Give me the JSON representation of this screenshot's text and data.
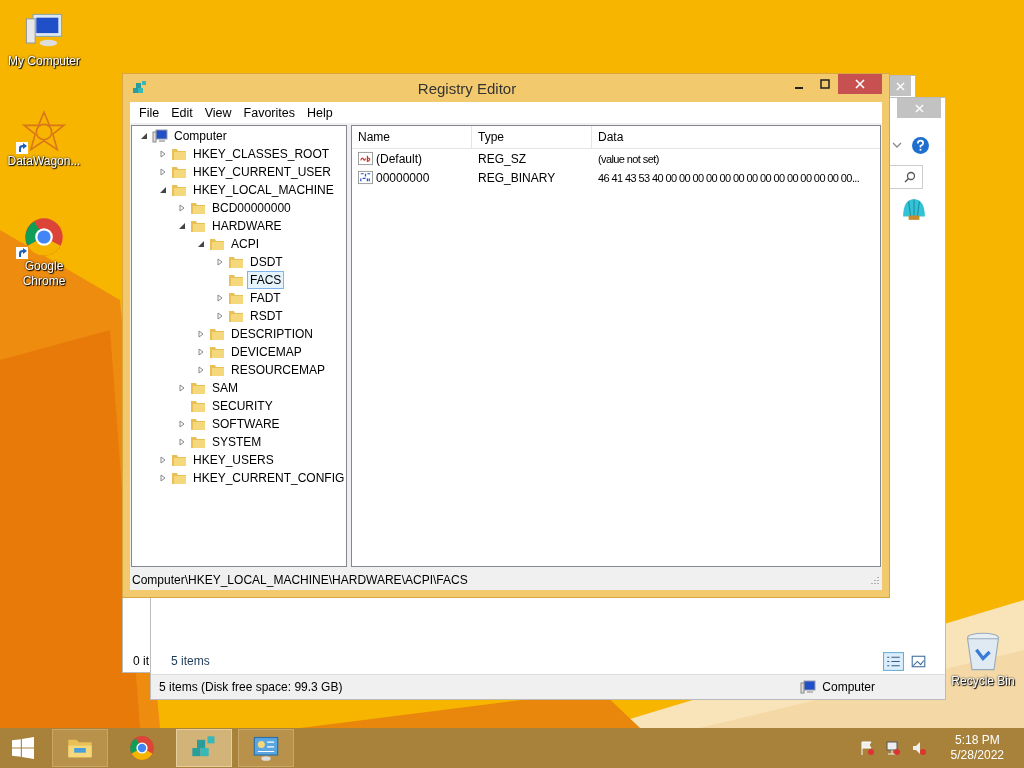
{
  "desktop_icons": [
    {
      "label": "My Computer",
      "kind": "computer",
      "shortcut": false
    },
    {
      "label": "DataWagon...",
      "kind": "star",
      "shortcut": true
    },
    {
      "label": "Google Chrome",
      "kind": "chrome",
      "shortcut": true
    },
    {
      "label": "Recycle Bin",
      "kind": "recycle",
      "shortcut": false
    }
  ],
  "background_windows": [
    {
      "status": "0 it"
    },
    {
      "items_count": "5 items",
      "status_text": "5 items (Disk free space: 99.3 GB)",
      "location": "Computer"
    }
  ],
  "registry_editor": {
    "title": "Registry Editor",
    "menu": [
      "File",
      "Edit",
      "View",
      "Favorites",
      "Help"
    ],
    "tree": [
      {
        "label": "Computer",
        "kind": "computer",
        "expandable": true,
        "expanded": true,
        "selected": false,
        "children": [
          {
            "label": "HKEY_CLASSES_ROOT",
            "kind": "folder",
            "expandable": true,
            "expanded": false,
            "selected": false
          },
          {
            "label": "HKEY_CURRENT_USER",
            "kind": "folder",
            "expandable": true,
            "expanded": false,
            "selected": false
          },
          {
            "label": "HKEY_LOCAL_MACHINE",
            "kind": "folder",
            "expandable": true,
            "expanded": true,
            "selected": false,
            "children": [
              {
                "label": "BCD00000000",
                "kind": "folder",
                "expandable": true,
                "expanded": false,
                "selected": false
              },
              {
                "label": "HARDWARE",
                "kind": "folder",
                "expandable": true,
                "expanded": true,
                "selected": false,
                "children": [
                  {
                    "label": "ACPI",
                    "kind": "folder",
                    "expandable": true,
                    "expanded": true,
                    "selected": false,
                    "children": [
                      {
                        "label": "DSDT",
                        "kind": "folder",
                        "expandable": true,
                        "expanded": false,
                        "selected": false
                      },
                      {
                        "label": "FACS",
                        "kind": "folder",
                        "expandable": false,
                        "selected": true
                      },
                      {
                        "label": "FADT",
                        "kind": "folder",
                        "expandable": true,
                        "expanded": false,
                        "selected": false
                      },
                      {
                        "label": "RSDT",
                        "kind": "folder",
                        "expandable": true,
                        "expanded": false,
                        "selected": false
                      }
                    ]
                  },
                  {
                    "label": "DESCRIPTION",
                    "kind": "folder",
                    "expandable": true,
                    "expanded": false,
                    "selected": false
                  },
                  {
                    "label": "DEVICEMAP",
                    "kind": "folder",
                    "expandable": true,
                    "expanded": false,
                    "selected": false
                  },
                  {
                    "label": "RESOURCEMAP",
                    "kind": "folder",
                    "expandable": true,
                    "expanded": false,
                    "selected": false
                  }
                ]
              },
              {
                "label": "SAM",
                "kind": "folder",
                "expandable": true,
                "expanded": false,
                "selected": false
              },
              {
                "label": "SECURITY",
                "kind": "folder",
                "expandable": false,
                "selected": false
              },
              {
                "label": "SOFTWARE",
                "kind": "folder",
                "expandable": true,
                "expanded": false,
                "selected": false
              },
              {
                "label": "SYSTEM",
                "kind": "folder",
                "expandable": true,
                "expanded": false,
                "selected": false
              }
            ]
          },
          {
            "label": "HKEY_USERS",
            "kind": "folder",
            "expandable": true,
            "expanded": false,
            "selected": false
          },
          {
            "label": "HKEY_CURRENT_CONFIG",
            "kind": "folder",
            "expandable": true,
            "expanded": false,
            "selected": false
          }
        ]
      }
    ],
    "columns": [
      "Name",
      "Type",
      "Data"
    ],
    "values": [
      {
        "name": "(Default)",
        "type": "REG_SZ",
        "data": "(value not set)",
        "kind": "string"
      },
      {
        "name": "00000000",
        "type": "REG_BINARY",
        "data": "46 41 43 53 40 00 00 00 00 00 00 00 00 00 00 00 00 00 00...",
        "kind": "binary"
      }
    ],
    "status_bar": "Computer\\HKEY_LOCAL_MACHINE\\HARDWARE\\ACPI\\FACS"
  },
  "taskbar": {
    "apps": [
      {
        "kind": "explorer",
        "running": true,
        "selected": false
      },
      {
        "kind": "chrome",
        "running": false,
        "selected": false
      },
      {
        "kind": "regedit",
        "running": true,
        "selected": true
      },
      {
        "kind": "control",
        "running": true,
        "selected": false
      }
    ],
    "time": "5:18 PM",
    "date": "5/28/2022"
  }
}
